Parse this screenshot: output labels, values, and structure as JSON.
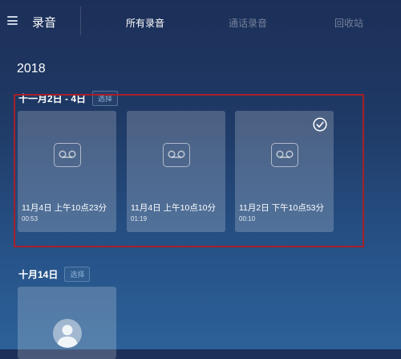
{
  "header": {
    "app_title": "录音",
    "tabs": [
      {
        "label": "所有录音",
        "active": true
      },
      {
        "label": "通话录音",
        "active": false
      },
      {
        "label": "回收站",
        "active": false
      }
    ]
  },
  "year": "2018",
  "groups": [
    {
      "label": "十一月2日 - 4日",
      "select_label": "选择",
      "recordings": [
        {
          "title": "11月4日 上午10点23分",
          "duration": "00:53",
          "icon": "voicemail-icon"
        },
        {
          "title": "11月4日 上午10点10分",
          "duration": "01:19",
          "icon": "voicemail-icon"
        },
        {
          "title": "11月2日 下午10点53分",
          "duration": "00:10",
          "icon": "voicemail-icon",
          "checked": true
        }
      ]
    },
    {
      "label": "十月14日",
      "select_label": "选择",
      "recordings": [
        {
          "icon": "contact-avatar-icon"
        }
      ]
    }
  ],
  "colors": {
    "background_top": "#1c2f58",
    "background_bottom": "#2c6198",
    "highlight_border": "#a52028",
    "select_text": "#8fb4d6"
  }
}
